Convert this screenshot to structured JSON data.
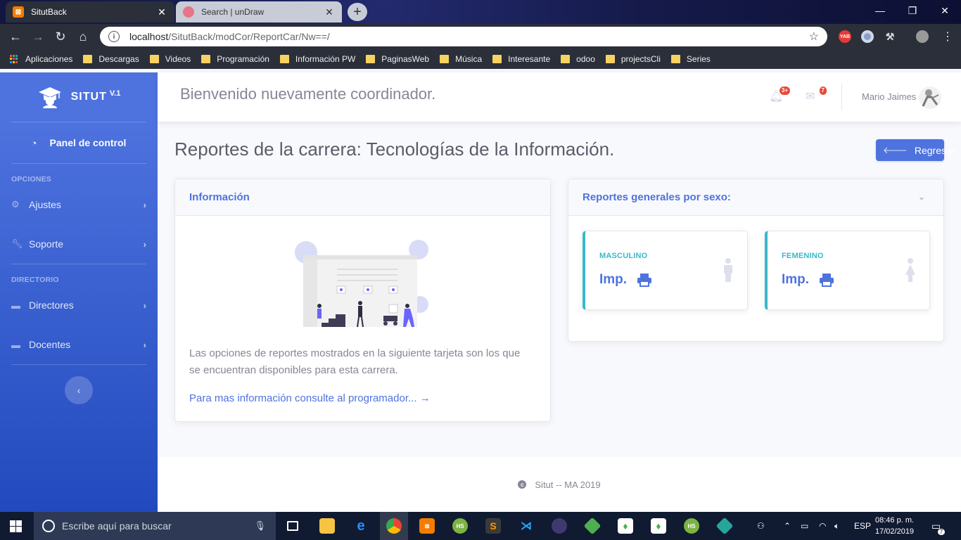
{
  "browser": {
    "tabs": [
      {
        "title": "SitutBack",
        "favicon_text": "⊠",
        "favicon_color": "#f57c00",
        "active": true
      },
      {
        "title": "Search | unDraw",
        "favicon_color": "#e8738a",
        "active": false
      }
    ],
    "new_tab": "+",
    "window_controls": {
      "minimize": "—",
      "restore": "❐",
      "close": "✕"
    },
    "nav": {
      "back": "←",
      "forward": "→",
      "reload": "↻",
      "home": "⌂"
    },
    "url": {
      "host": "localhost",
      "path": "/SitutBack/modCor/ReportCar/Nw==/"
    },
    "extensions": [
      {
        "name": "yab-extension-icon",
        "label": "YAB",
        "color": "#e53935"
      },
      {
        "name": "circle-extension-icon",
        "label": "",
        "color": "#8aa0c8"
      },
      {
        "name": "tool-extension-icon",
        "label": "",
        "color": "#555555"
      }
    ],
    "bookmarks": [
      {
        "label": "Aplicaciones",
        "type": "apps"
      },
      {
        "label": "Descargas",
        "type": "folder"
      },
      {
        "label": "Videos",
        "type": "folder"
      },
      {
        "label": "Programación",
        "type": "folder"
      },
      {
        "label": "Información PW",
        "type": "folder"
      },
      {
        "label": "PaginasWeb",
        "type": "folder"
      },
      {
        "label": "Música",
        "type": "folder"
      },
      {
        "label": "Interesante",
        "type": "folder"
      },
      {
        "label": "odoo",
        "type": "folder"
      },
      {
        "label": "projectsCli",
        "type": "folder"
      },
      {
        "label": "Series",
        "type": "folder"
      }
    ]
  },
  "sidebar": {
    "brand": {
      "name": "SITUT",
      "version": "V.1"
    },
    "dashboard": {
      "label": "Panel de control",
      "icon": "tachometer-icon"
    },
    "sections": [
      {
        "heading": "OPCIONES",
        "items": [
          {
            "label": "Ajustes",
            "icon": "cogs-icon"
          },
          {
            "label": "Soporte",
            "icon": "wrench-icon"
          }
        ]
      },
      {
        "heading": "DIRECTORIO",
        "items": [
          {
            "label": "Directores",
            "icon": "folder-icon"
          },
          {
            "label": "Docentes",
            "icon": "folder-icon"
          }
        ]
      }
    ],
    "toggle": "‹"
  },
  "topbar": {
    "welcome": "Bienvenido nuevamente coordinador.",
    "alerts_badge": "3+",
    "messages_badge": "7",
    "user_name": "Mario Jaimes"
  },
  "main": {
    "title": "Reportes de la carrera: Tecnologías de la Información.",
    "back_button": "Regresar",
    "info_card": {
      "header": "Información",
      "description": "Las opciones de reportes mostrados en la siguiente tarjeta son los que se encuentran disponibles para esta carrera.",
      "link": "Para mas información consulte al programador... →"
    },
    "reports_card": {
      "header": "Reportes generales por sexo:",
      "items": [
        {
          "label": "MASCULINO",
          "action": "Imp.",
          "icon": "male-icon"
        },
        {
          "label": "FEMENINO",
          "action": "Imp.",
          "icon": "female-icon"
        }
      ]
    }
  },
  "footer": {
    "copyright": "Situt -- MA 2019"
  },
  "colors": {
    "primary": "#4e73df",
    "info": "#36b9cc",
    "danger": "#e74a3b",
    "text_muted": "#858796"
  },
  "taskbar": {
    "search_placeholder": "Escribe aquí para buscar",
    "language": "ESP",
    "time": "08:46 p. m.",
    "date": "17/02/2019",
    "notifications": "7"
  }
}
